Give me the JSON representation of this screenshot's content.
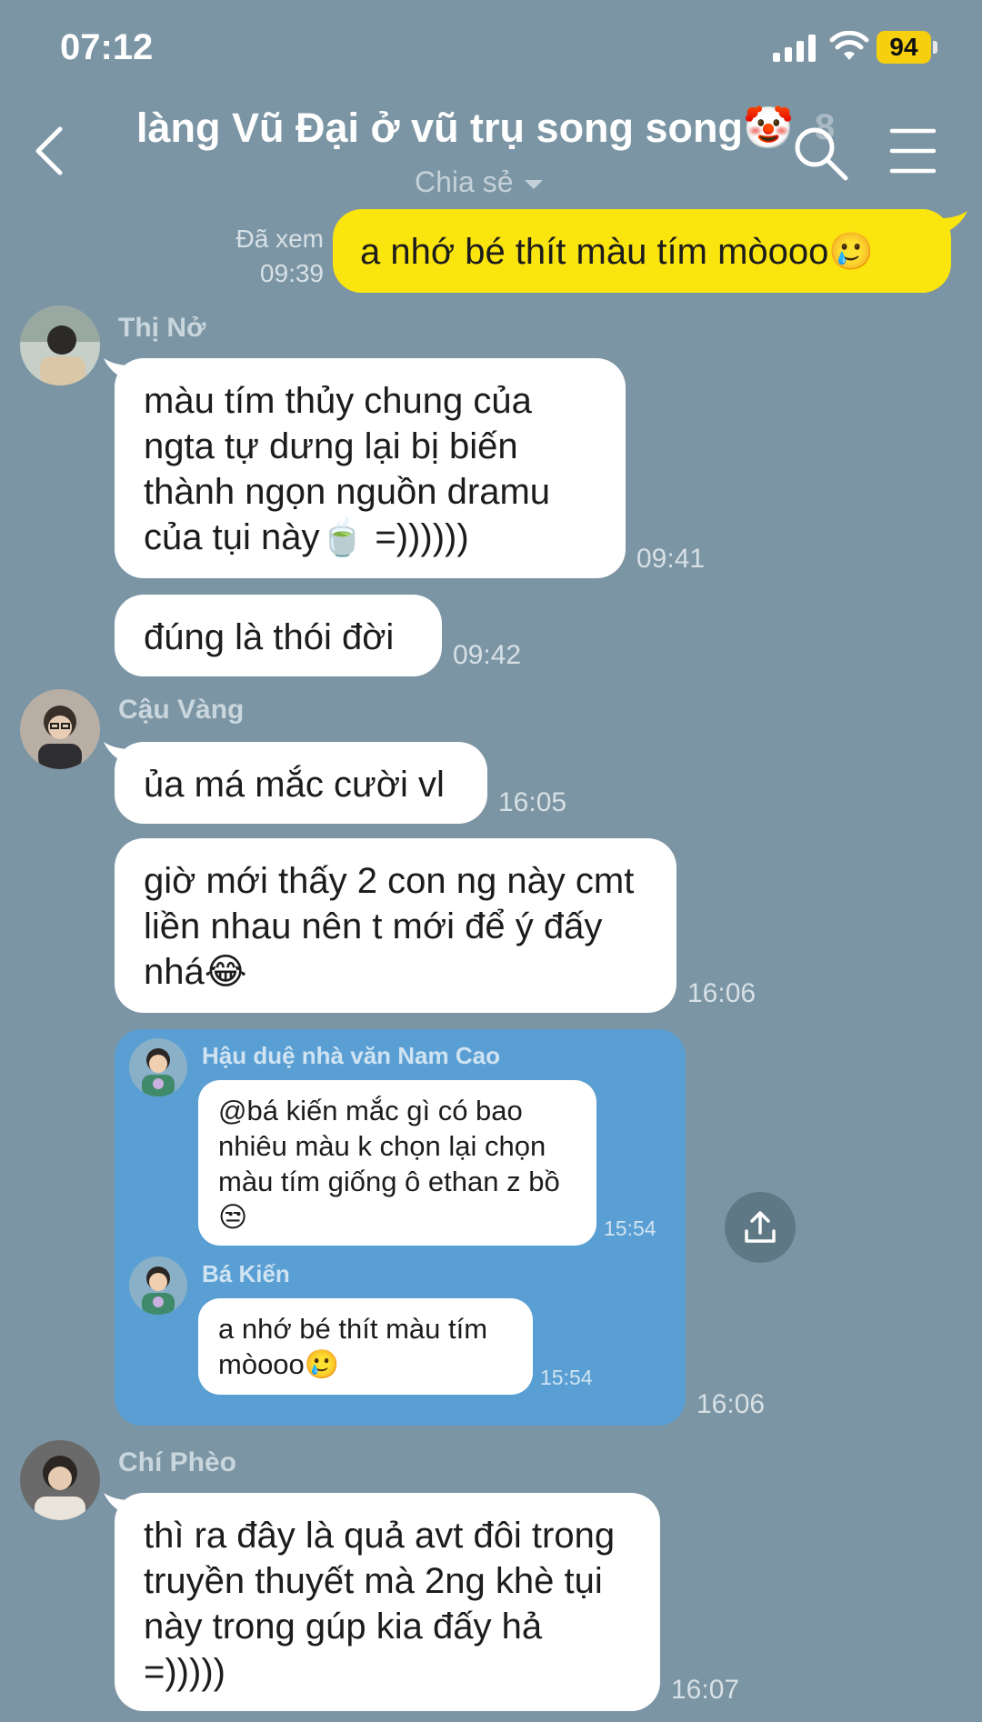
{
  "status_bar": {
    "time": "07:12",
    "battery": "94"
  },
  "header": {
    "title": "làng Vũ Đại ở vũ trụ song song🤡",
    "member_count": "8",
    "subtitle": "Chia sẻ"
  },
  "messages": {
    "m1": {
      "text": "a nhớ bé thít màu tím mòooo🥲",
      "seen": "Đã xem",
      "time": "09:39"
    },
    "m2": {
      "sender": "Thị Nở",
      "text": "màu tím thủy chung của ngta tự dưng lại bị biến thành ngọn nguồn dramu của tụi này🍵 =))))))",
      "time": "09:41"
    },
    "m3": {
      "text": "đúng là thói đời",
      "time": "09:42"
    },
    "m4": {
      "sender": "Cậu Vàng",
      "text": "ủa má mắc cười vl",
      "time": "16:05"
    },
    "m5": {
      "text": "giờ mới thấy 2 con ng này cmt liền nhau nên t mới để ý đấy nhá😂",
      "time": "16:06"
    },
    "fwd": {
      "time": "16:06",
      "items": [
        {
          "sender": "Hậu duệ nhà văn Nam Cao",
          "text": "@bá kiến mắc gì có bao nhiêu màu k chọn lại chọn màu tím giống ô ethan z bồ😒",
          "time": "15:54"
        },
        {
          "sender": "Bá Kiến",
          "text": "a nhớ bé thít màu tím mòooo🥲",
          "time": "15:54"
        }
      ]
    },
    "m6": {
      "sender": "Chí Phèo",
      "text": "thì ra đây là quả avt đôi trong truyền thuyết mà 2ng khè tụi này trong gúp kia đấy hả =)))))",
      "time": "16:07"
    }
  },
  "icons": {
    "back": "chevron-left-icon",
    "search": "search-icon",
    "menu": "menu-icon",
    "share": "share-icon"
  }
}
